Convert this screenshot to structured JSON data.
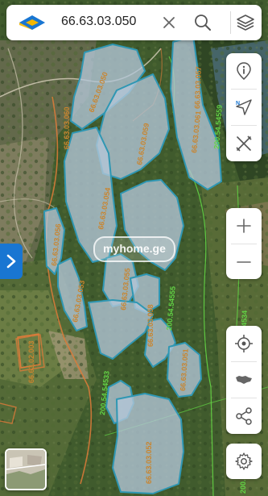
{
  "search": {
    "query": "66.63.03.050"
  },
  "watermark": {
    "text": "myhome.ge"
  },
  "colors": {
    "brand_blue": "#1976d2",
    "brand_yellow": "#f5b700",
    "parcel_fill": "#a8bfd4",
    "parcel_stroke": "#2f97b3",
    "parcel_label": "#c9852f",
    "green_boundary": "#63d445"
  },
  "map": {
    "parcel_labels": [
      "66.63.03.060",
      "66.63.03.050",
      "66.63.03.057",
      "66.63.03.059",
      "66.63.03.061",
      "66.63.03.054",
      "66.63.03.056",
      "66.63.03.055",
      "66.63.03.053",
      "66.63.03.058",
      "66.63.03.051",
      "66.63.02.003",
      "66.63.03.052"
    ],
    "boundary_labels": [
      "200.54.54559",
      "200.54.54555",
      "200.54.54533",
      "200.54.54534",
      "200.54.54507"
    ]
  },
  "icons": {
    "logo": "myhome-logo",
    "clear": "close-icon",
    "search": "search-icon",
    "layers": "layers-icon",
    "info": "info-pin-icon",
    "navigate": "navigation-arrow-icon",
    "tools": "ruler-pencil-tools-icon",
    "zoom_in": "plus-icon",
    "zoom_out": "minus-icon",
    "locate": "crosshair-location-icon",
    "country": "georgia-map-icon",
    "share": "share-icon",
    "settings": "gear-icon",
    "expand": "chevron-right-icon",
    "basemap": "basemap-thumbnail"
  }
}
